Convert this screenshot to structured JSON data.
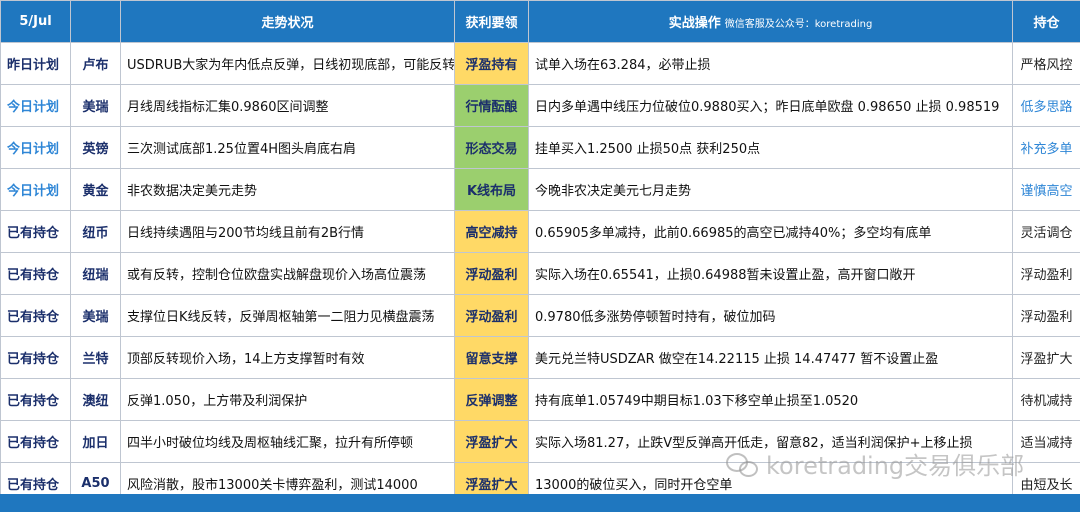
{
  "header": {
    "date": "5/Jul",
    "trend": "走势状况",
    "key": "获利要领",
    "action": "实战操作",
    "action_sub": "微信客服及公众号：koretrading",
    "position": "持仓"
  },
  "rows": [
    {
      "status": "昨日计划",
      "currency": "卢布",
      "trend": "USDRUB大家为年内低点反弹，日线初现底部，可能反转",
      "key": "浮盈持有",
      "action": "试单入场在63.284，必带止损",
      "position": "严格风控"
    },
    {
      "status": "今日计划",
      "currency": "美瑞",
      "trend": "月线周线指标汇集0.9860区间调整",
      "key": "行情酝酿",
      "action": "日内多单遇中线压力位破位0.9880买入；昨日底单欧盘 0.98650  止损 0.98519",
      "position": "低多思路"
    },
    {
      "status": "今日计划",
      "currency": "英镑",
      "trend": "三次测试底部1.25位置4H图头肩底右肩",
      "key": "形态交易",
      "action": "挂单买入1.2500 止损50点 获利250点",
      "position": "补充多单"
    },
    {
      "status": "今日计划",
      "currency": "黄金",
      "trend": "非农数据决定美元走势",
      "key": "K线布局",
      "action": "今晚非农决定美元七月走势",
      "position": "谨慎高空"
    },
    {
      "status": "已有持仓",
      "currency": "纽币",
      "trend": "日线持续遇阻与200节均线且前有2B行情",
      "key": "高空减持",
      "action": "0.65905多单减持，此前0.66985的高空已减持40%；多空均有底单",
      "position": "灵活调仓"
    },
    {
      "status": "已有持仓",
      "currency": "纽瑞",
      "trend": "或有反转，控制仓位欧盘实战解盘现价入场高位震荡",
      "key": "浮动盈利",
      "action": "实际入场在0.65541，止损0.64988暂未设置止盈，高开窗口敞开",
      "position": "浮动盈利"
    },
    {
      "status": "已有持仓",
      "currency": "美瑞",
      "trend": "支撑位日K线反转，反弹周枢轴第一二阻力见横盘震荡",
      "key": "浮动盈利",
      "action": "0.9780低多涨势停顿暂时持有，破位加码",
      "position": "浮动盈利"
    },
    {
      "status": "已有持仓",
      "currency": "兰特",
      "trend": "顶部反转现价入场，14上方支撑暂时有效",
      "key": "留意支撑",
      "action": "美元兑兰特USDZAR 做空在14.22115  止损 14.47477 暂不设置止盈",
      "position": "浮盈扩大"
    },
    {
      "status": "已有持仓",
      "currency": "澳纽",
      "trend": "反弹1.050，上方带及利润保护",
      "key": "反弹调整",
      "action": "持有底单1.05749中期目标1.03下移空单止损至1.0520",
      "position": "待机减持"
    },
    {
      "status": "已有持仓",
      "currency": "加日",
      "trend": "四半小时破位均线及周枢轴线汇聚，拉升有所停顿",
      "key": "浮盈扩大",
      "action": "实际入场81.27，止跌V型反弹高开低走，留意82，适当利润保护+上移止损",
      "position": "适当减持"
    },
    {
      "status": "已有持仓",
      "currency": "A50",
      "trend": "风险消散，股市13000关卡博弈盈利，测试14000",
      "key": "浮盈扩大",
      "action": "13000的破位买入，同时开仓空单",
      "position": "由短及长"
    }
  ],
  "watermark": "koretrading交易俱乐部",
  "colors": {
    "header_bg": "#1f77bf",
    "key_yellow": "#ffd966",
    "key_green": "#9bcf6e",
    "today_blue": "#2e86d6",
    "navy": "#1b2f6b"
  }
}
